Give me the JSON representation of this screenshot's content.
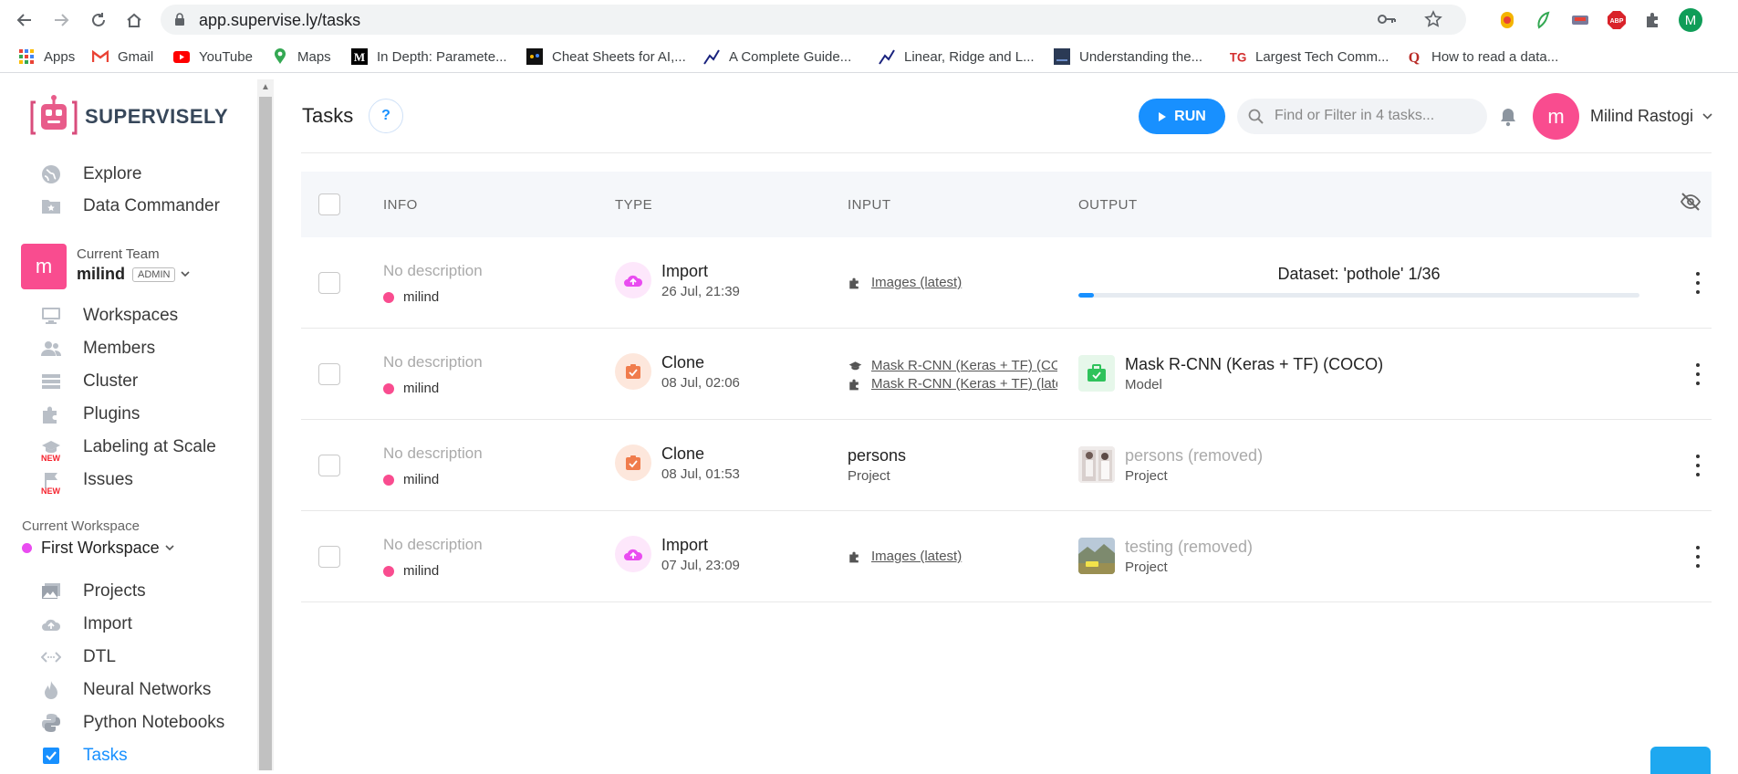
{
  "browser": {
    "url": "app.supervise.ly/tasks",
    "bookmarks": [
      {
        "label": "Apps",
        "icon": "apps-grid-icon"
      },
      {
        "label": "Gmail",
        "icon": "gmail-icon"
      },
      {
        "label": "YouTube",
        "icon": "youtube-icon"
      },
      {
        "label": "Maps",
        "icon": "maps-icon"
      },
      {
        "label": "In Depth: Paramete...",
        "icon": "medium-icon"
      },
      {
        "label": "Cheat Sheets for AI,...",
        "icon": "bookmark-favicon"
      },
      {
        "label": "A Complete Guide...",
        "icon": "chart-favicon"
      },
      {
        "label": "Linear, Ridge and L...",
        "icon": "chart-favicon"
      },
      {
        "label": "Understanding the...",
        "icon": "bookmark-favicon"
      },
      {
        "label": "Largest Tech Comm...",
        "icon": "tg-icon"
      },
      {
        "label": "How to read a data...",
        "icon": "quora-icon"
      }
    ],
    "profile_initial": "M"
  },
  "sidebar": {
    "logo_text": "SUPERVISELY",
    "top_items": [
      {
        "label": "Explore",
        "icon": "globe-icon"
      },
      {
        "label": "Data Commander",
        "icon": "folder-star-icon"
      }
    ],
    "team": {
      "label": "Current Team",
      "name": "milind",
      "role": "ADMIN",
      "avatar": "m"
    },
    "team_items": [
      {
        "label": "Workspaces",
        "icon": "monitor-icon"
      },
      {
        "label": "Members",
        "icon": "users-icon"
      },
      {
        "label": "Cluster",
        "icon": "server-icon"
      },
      {
        "label": "Plugins",
        "icon": "puzzle-icon"
      },
      {
        "label": "Labeling at Scale",
        "icon": "graduation-cap-icon",
        "badge": "NEW"
      },
      {
        "label": "Issues",
        "icon": "flag-icon",
        "badge": "NEW"
      }
    ],
    "workspace": {
      "label": "Current Workspace",
      "name": "First Workspace"
    },
    "workspace_items": [
      {
        "label": "Projects",
        "icon": "images-icon"
      },
      {
        "label": "Import",
        "icon": "cloud-upload-icon"
      },
      {
        "label": "DTL",
        "icon": "code-icon"
      },
      {
        "label": "Neural Networks",
        "icon": "fire-icon"
      },
      {
        "label": "Python Notebooks",
        "icon": "python-icon"
      },
      {
        "label": "Tasks",
        "icon": "checkbox-icon",
        "active": true
      }
    ]
  },
  "header": {
    "title": "Tasks",
    "help": "?",
    "run_label": "RUN",
    "search_placeholder": "Find or Filter in 4 tasks...",
    "user_name": "Milind Rastogi",
    "user_initial": "m"
  },
  "table": {
    "columns": [
      "INFO",
      "TYPE",
      "INPUT",
      "OUTPUT"
    ],
    "rows": [
      {
        "description": "No description",
        "owner": "milind",
        "type": "Import",
        "date": "26 Jul, 21:39",
        "input_links": [
          "Images (latest)"
        ],
        "output_title": "Dataset: 'pothole' 1/36",
        "progress": 0.028
      },
      {
        "description": "No description",
        "owner": "milind",
        "type": "Clone",
        "date": "08 Jul, 02:06",
        "input_links": [
          "Mask R-CNN (Keras + TF) (COCO)",
          "Mask R-CNN (Keras + TF) (latest)"
        ],
        "output_name": "Mask R-CNN (Keras + TF) (COCO)",
        "output_sub": "Model"
      },
      {
        "description": "No description",
        "owner": "milind",
        "type": "Clone",
        "date": "08 Jul, 01:53",
        "input_name": "persons",
        "input_sub": "Project",
        "output_name": "persons (removed)",
        "output_sub": "Project"
      },
      {
        "description": "No description",
        "owner": "milind",
        "type": "Import",
        "date": "07 Jul, 23:09",
        "input_links": [
          "Images (latest)"
        ],
        "output_name": "testing (removed)",
        "output_sub": "Project"
      }
    ]
  },
  "colors": {
    "accent": "#1890ff",
    "avatar": "#f94c8f",
    "import_bg": "#fde7fb",
    "clone_bg": "#fde7dc"
  }
}
